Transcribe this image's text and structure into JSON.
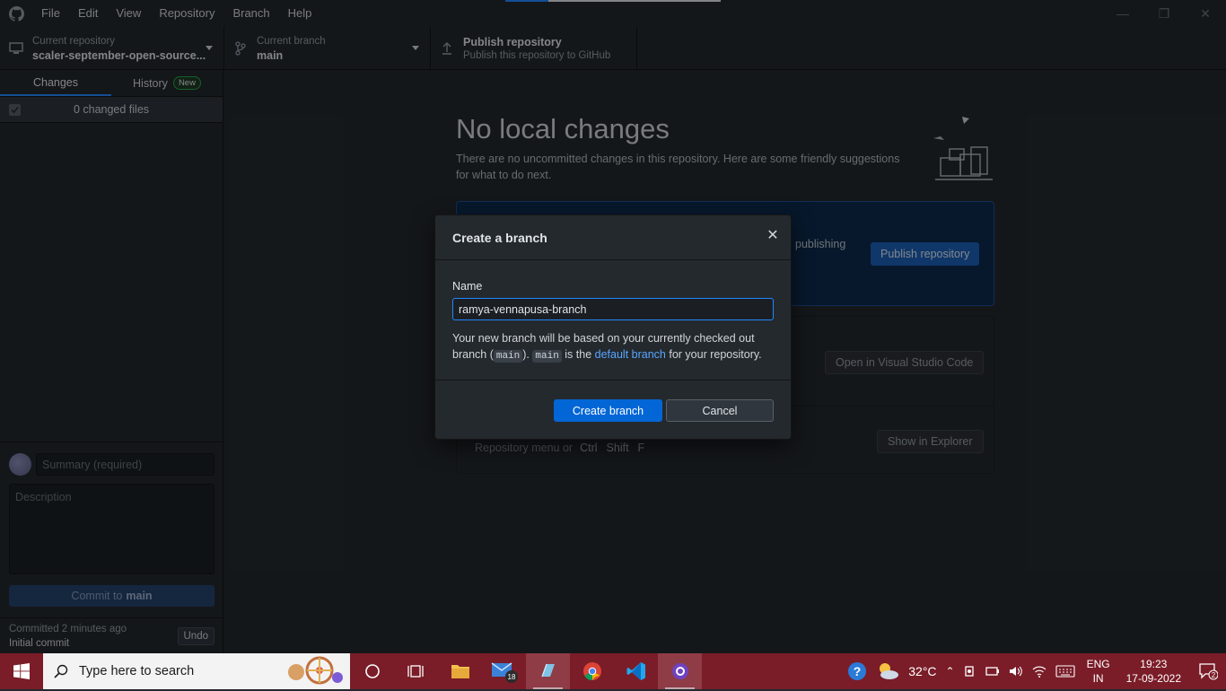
{
  "menu": [
    "File",
    "Edit",
    "View",
    "Repository",
    "Branch",
    "Help"
  ],
  "toolbar": {
    "repo_label": "Current repository",
    "repo_value": "scaler-september-open-source...",
    "branch_label": "Current branch",
    "branch_value": "main",
    "publish_label": "Publish repository",
    "publish_sub": "Publish this repository to GitHub"
  },
  "sidebar": {
    "tab_changes": "Changes",
    "tab_history": "History",
    "history_badge": "New",
    "changed_files": "0 changed files",
    "summary_placeholder": "Summary (required)",
    "description_placeholder": "Description",
    "commit_prefix": "Commit to",
    "commit_branch": "main",
    "last_commit_time": "Committed 2 minutes ago",
    "last_commit_msg": "Initial commit",
    "undo_label": "Undo"
  },
  "main": {
    "title": "No local changes",
    "subtitle": "There are no uncommitted changes in this repository. Here are some friendly suggestions for what to do next.",
    "publish_panel_text": "publishing",
    "publish_button": "Publish repository",
    "vscode_button": "Open in Visual Studio Code",
    "explorer_button": "Show in Explorer",
    "repo_hint_text": "Repository menu or",
    "repo_hint_keys": [
      "Ctrl",
      "Shift",
      "F"
    ]
  },
  "dialog": {
    "title": "Create a branch",
    "name_label": "Name",
    "name_value": "ramya-vennapusa-branch",
    "note_part1": "Your new branch will be based on your currently checked out branch (",
    "note_code1": "main",
    "note_part2": ").",
    "note_code2": "main",
    "note_part3": "is the",
    "note_link": "default branch",
    "note_part4": "for your repository.",
    "create_button": "Create branch",
    "cancel_button": "Cancel"
  },
  "taskbar": {
    "search_placeholder": "Type here to search",
    "mail_badge": "18",
    "temperature": "32°C",
    "lang_line1": "ENG",
    "lang_line2": "IN",
    "time": "19:23",
    "date": "17-09-2022",
    "notification_count": "2"
  },
  "colors": {
    "accent": "#0366d6",
    "taskbar": "#7a1d28",
    "link": "#58a6ff"
  }
}
